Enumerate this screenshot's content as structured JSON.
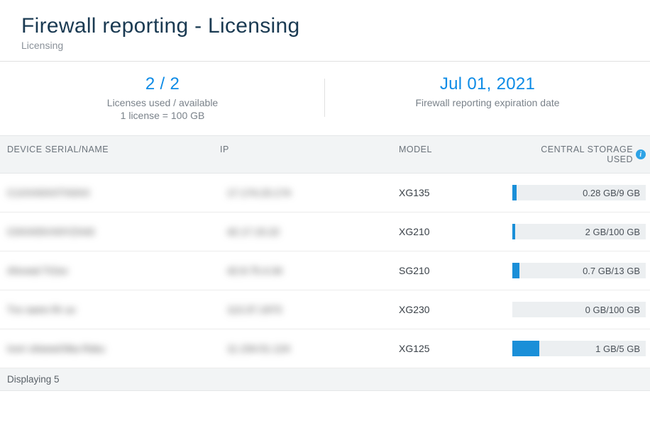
{
  "header": {
    "title": "Firewall reporting - Licensing",
    "subtitle": "Licensing"
  },
  "summary": {
    "licenses": {
      "value": "2 / 2",
      "label": "Licenses used / available",
      "note": "1 license = 100 GB"
    },
    "expiration": {
      "value": "Jul 01, 2021",
      "label": "Firewall reporting expiration date"
    }
  },
  "table": {
    "columns": {
      "device": "DEVICE SERIAL/NAME",
      "ip": "IP",
      "model": "MODEL",
      "storage": "CENTRAL STORAGE USED"
    },
    "rows": [
      {
        "device": "C1XXX0XXTX0XX",
        "ip": "17.174.23.174",
        "model": "XG135",
        "storage_used": 0.28,
        "storage_total": 9,
        "storage_label": "0.28 GB/9 GB",
        "fill_pct": 3.1
      },
      {
        "device": "C0XX0SVX0YZX43",
        "ip": "42.17.15.22",
        "model": "XG210",
        "storage_used": 2,
        "storage_total": 100,
        "storage_label": "2 GB/100 GB",
        "fill_pct": 2
      },
      {
        "device": "Ahvved Tr2ov",
        "ip": "42.8.75.4.34",
        "model": "SG210",
        "storage_used": 0.7,
        "storage_total": 13,
        "storage_label": "0.7 GB/13 GB",
        "fill_pct": 5.4
      },
      {
        "device": "Tvv swnn Rr uv",
        "ip": "113.37.1973",
        "model": "XG230",
        "storage_used": 0,
        "storage_total": 100,
        "storage_label": "0 GB/100 GB",
        "fill_pct": 0
      },
      {
        "device": "Ivvrr oheewOIka Rsku",
        "ip": "11.154.51.124",
        "model": "XG125",
        "storage_used": 1,
        "storage_total": 5,
        "storage_label": "1 GB/5 GB",
        "fill_pct": 20
      }
    ],
    "footer": "Displaying 5"
  }
}
